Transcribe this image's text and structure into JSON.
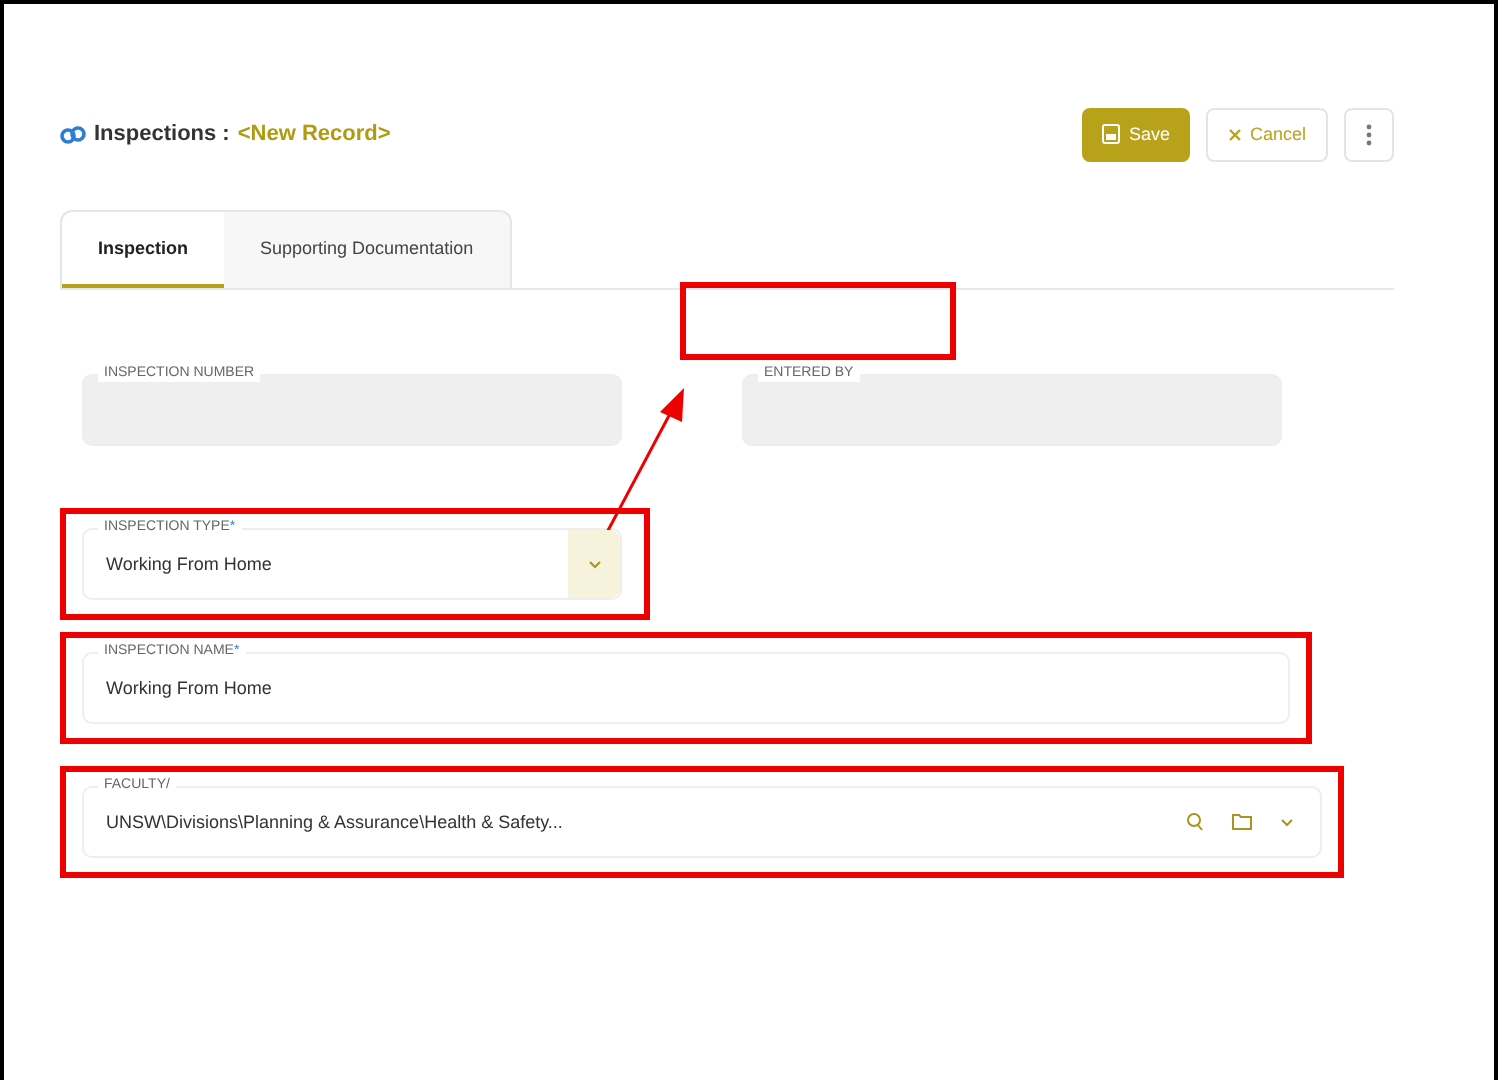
{
  "header": {
    "module": "Inspections :",
    "record": "<New Record>"
  },
  "actions": [
    {
      "kind": "save",
      "label": "Save"
    },
    {
      "kind": "cancel",
      "label": "Cancel"
    },
    {
      "kind": "more"
    }
  ],
  "tabs": [
    {
      "label": "Inspection",
      "selected": true
    },
    {
      "label": "Supporting Documentation",
      "selected": false
    }
  ],
  "rows": [
    {
      "fields": [
        {
          "kind": "text",
          "label": "INSPECTION NUMBER",
          "readonly": true
        },
        {
          "kind": "text",
          "label": "ENTERED BY",
          "readonly": true
        }
      ]
    },
    {
      "highlighted": true,
      "fields": [
        {
          "kind": "select",
          "label": "INSPECTION TYPE",
          "required_mark": "*",
          "value": "Working From Home"
        }
      ]
    },
    {
      "highlighted": true,
      "fields": [
        {
          "kind": "text",
          "label": "INSPECTION NAME",
          "required_mark": "*",
          "value": "Working From Home"
        }
      ]
    },
    {
      "highlighted": true,
      "fields": [
        {
          "kind": "lookup",
          "label": "FACULTY/",
          "value": "UNSW\\Divisions\\Planning & Assurance\\Health & Safety..."
        }
      ]
    }
  ],
  "annotations": [
    {
      "kind": "box"
    },
    {
      "kind": "arrow"
    }
  ]
}
